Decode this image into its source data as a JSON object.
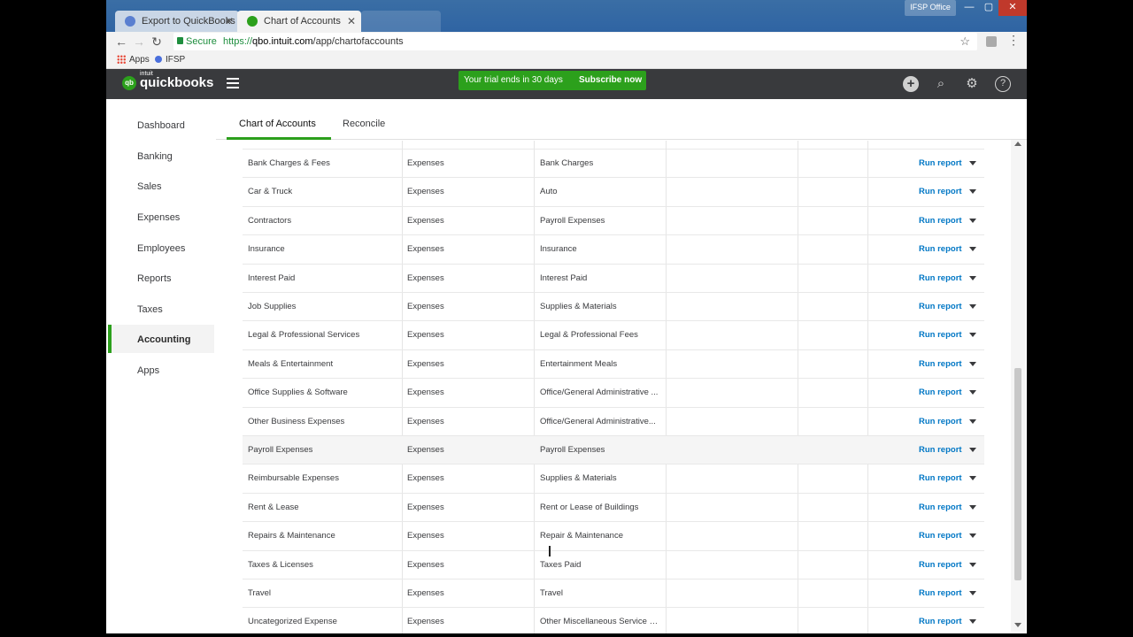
{
  "browser": {
    "tabs": [
      {
        "label": "Export to QuickBooks - I"
      },
      {
        "label": "Chart of Accounts"
      }
    ],
    "window_user": "IFSP Office",
    "url_secure_label": "Secure",
    "url_scheme": "https://",
    "url_host": "qbo.intuit.com",
    "url_path": "/app/chartofaccounts",
    "bookmarks": [
      {
        "label": "Apps"
      },
      {
        "label": "IFSP"
      }
    ]
  },
  "header": {
    "brand_top": "intuit",
    "brand": "quickbooks",
    "logo_text": "qb",
    "trial_text": "Your trial ends in 30 days",
    "subscribe_label": "Subscribe now",
    "accent": "#2ca01c",
    "background": "#393a3d"
  },
  "sidebar": {
    "items": [
      {
        "label": "Dashboard"
      },
      {
        "label": "Banking"
      },
      {
        "label": "Sales"
      },
      {
        "label": "Expenses"
      },
      {
        "label": "Employees"
      },
      {
        "label": "Reports"
      },
      {
        "label": "Taxes"
      },
      {
        "label": "Accounting"
      },
      {
        "label": "Apps"
      }
    ],
    "active": "Accounting"
  },
  "main": {
    "tabs": [
      {
        "label": "Chart of Accounts"
      },
      {
        "label": "Reconcile"
      }
    ],
    "action_label": "Run report",
    "action_color": "#0077c5",
    "rows": [
      {
        "name": "Bank Charges & Fees",
        "type": "Expenses",
        "detail": "Bank Charges"
      },
      {
        "name": "Car & Truck",
        "type": "Expenses",
        "detail": "Auto"
      },
      {
        "name": "Contractors",
        "type": "Expenses",
        "detail": "Payroll Expenses"
      },
      {
        "name": "Insurance",
        "type": "Expenses",
        "detail": "Insurance"
      },
      {
        "name": "Interest Paid",
        "type": "Expenses",
        "detail": "Interest Paid"
      },
      {
        "name": "Job Supplies",
        "type": "Expenses",
        "detail": "Supplies & Materials"
      },
      {
        "name": "Legal & Professional Services",
        "type": "Expenses",
        "detail": "Legal & Professional Fees"
      },
      {
        "name": "Meals & Entertainment",
        "type": "Expenses",
        "detail": "Entertainment Meals"
      },
      {
        "name": "Office Supplies & Software",
        "type": "Expenses",
        "detail": "Office/General Administrative ..."
      },
      {
        "name": "Other Business Expenses",
        "type": "Expenses",
        "detail": "Office/General Administrative..."
      },
      {
        "name": "Payroll Expenses",
        "type": "Expenses",
        "detail": "Payroll Expenses"
      },
      {
        "name": "Reimbursable Expenses",
        "type": "Expenses",
        "detail": "Supplies & Materials"
      },
      {
        "name": "Rent & Lease",
        "type": "Expenses",
        "detail": "Rent or Lease of Buildings"
      },
      {
        "name": "Repairs & Maintenance",
        "type": "Expenses",
        "detail": "Repair & Maintenance"
      },
      {
        "name": "Taxes & Licenses",
        "type": "Expenses",
        "detail": "Taxes Paid"
      },
      {
        "name": "Travel",
        "type": "Expenses",
        "detail": "Travel"
      },
      {
        "name": "Uncategorized Expense",
        "type": "Expenses",
        "detail": "Other Miscellaneous Service C..."
      }
    ]
  }
}
